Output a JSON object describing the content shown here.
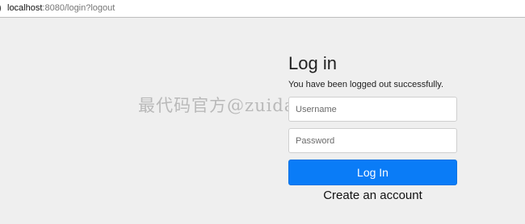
{
  "browser": {
    "url_host": "localhost",
    "url_rest": ":8080/login?logout",
    "page_icon": "info-icon"
  },
  "login": {
    "title": "Log in",
    "message": "You have been logged out successfully.",
    "username_placeholder": "Username",
    "username_value": "",
    "password_placeholder": "Password",
    "password_value": "",
    "submit_label": "Log In",
    "create_account_label": "Create an account"
  },
  "watermark": {
    "text": "最代码官方@zuidaima.com"
  },
  "colors": {
    "page_background": "#efefef",
    "primary_button": "#0a7cf7",
    "watermark": "#787878"
  }
}
